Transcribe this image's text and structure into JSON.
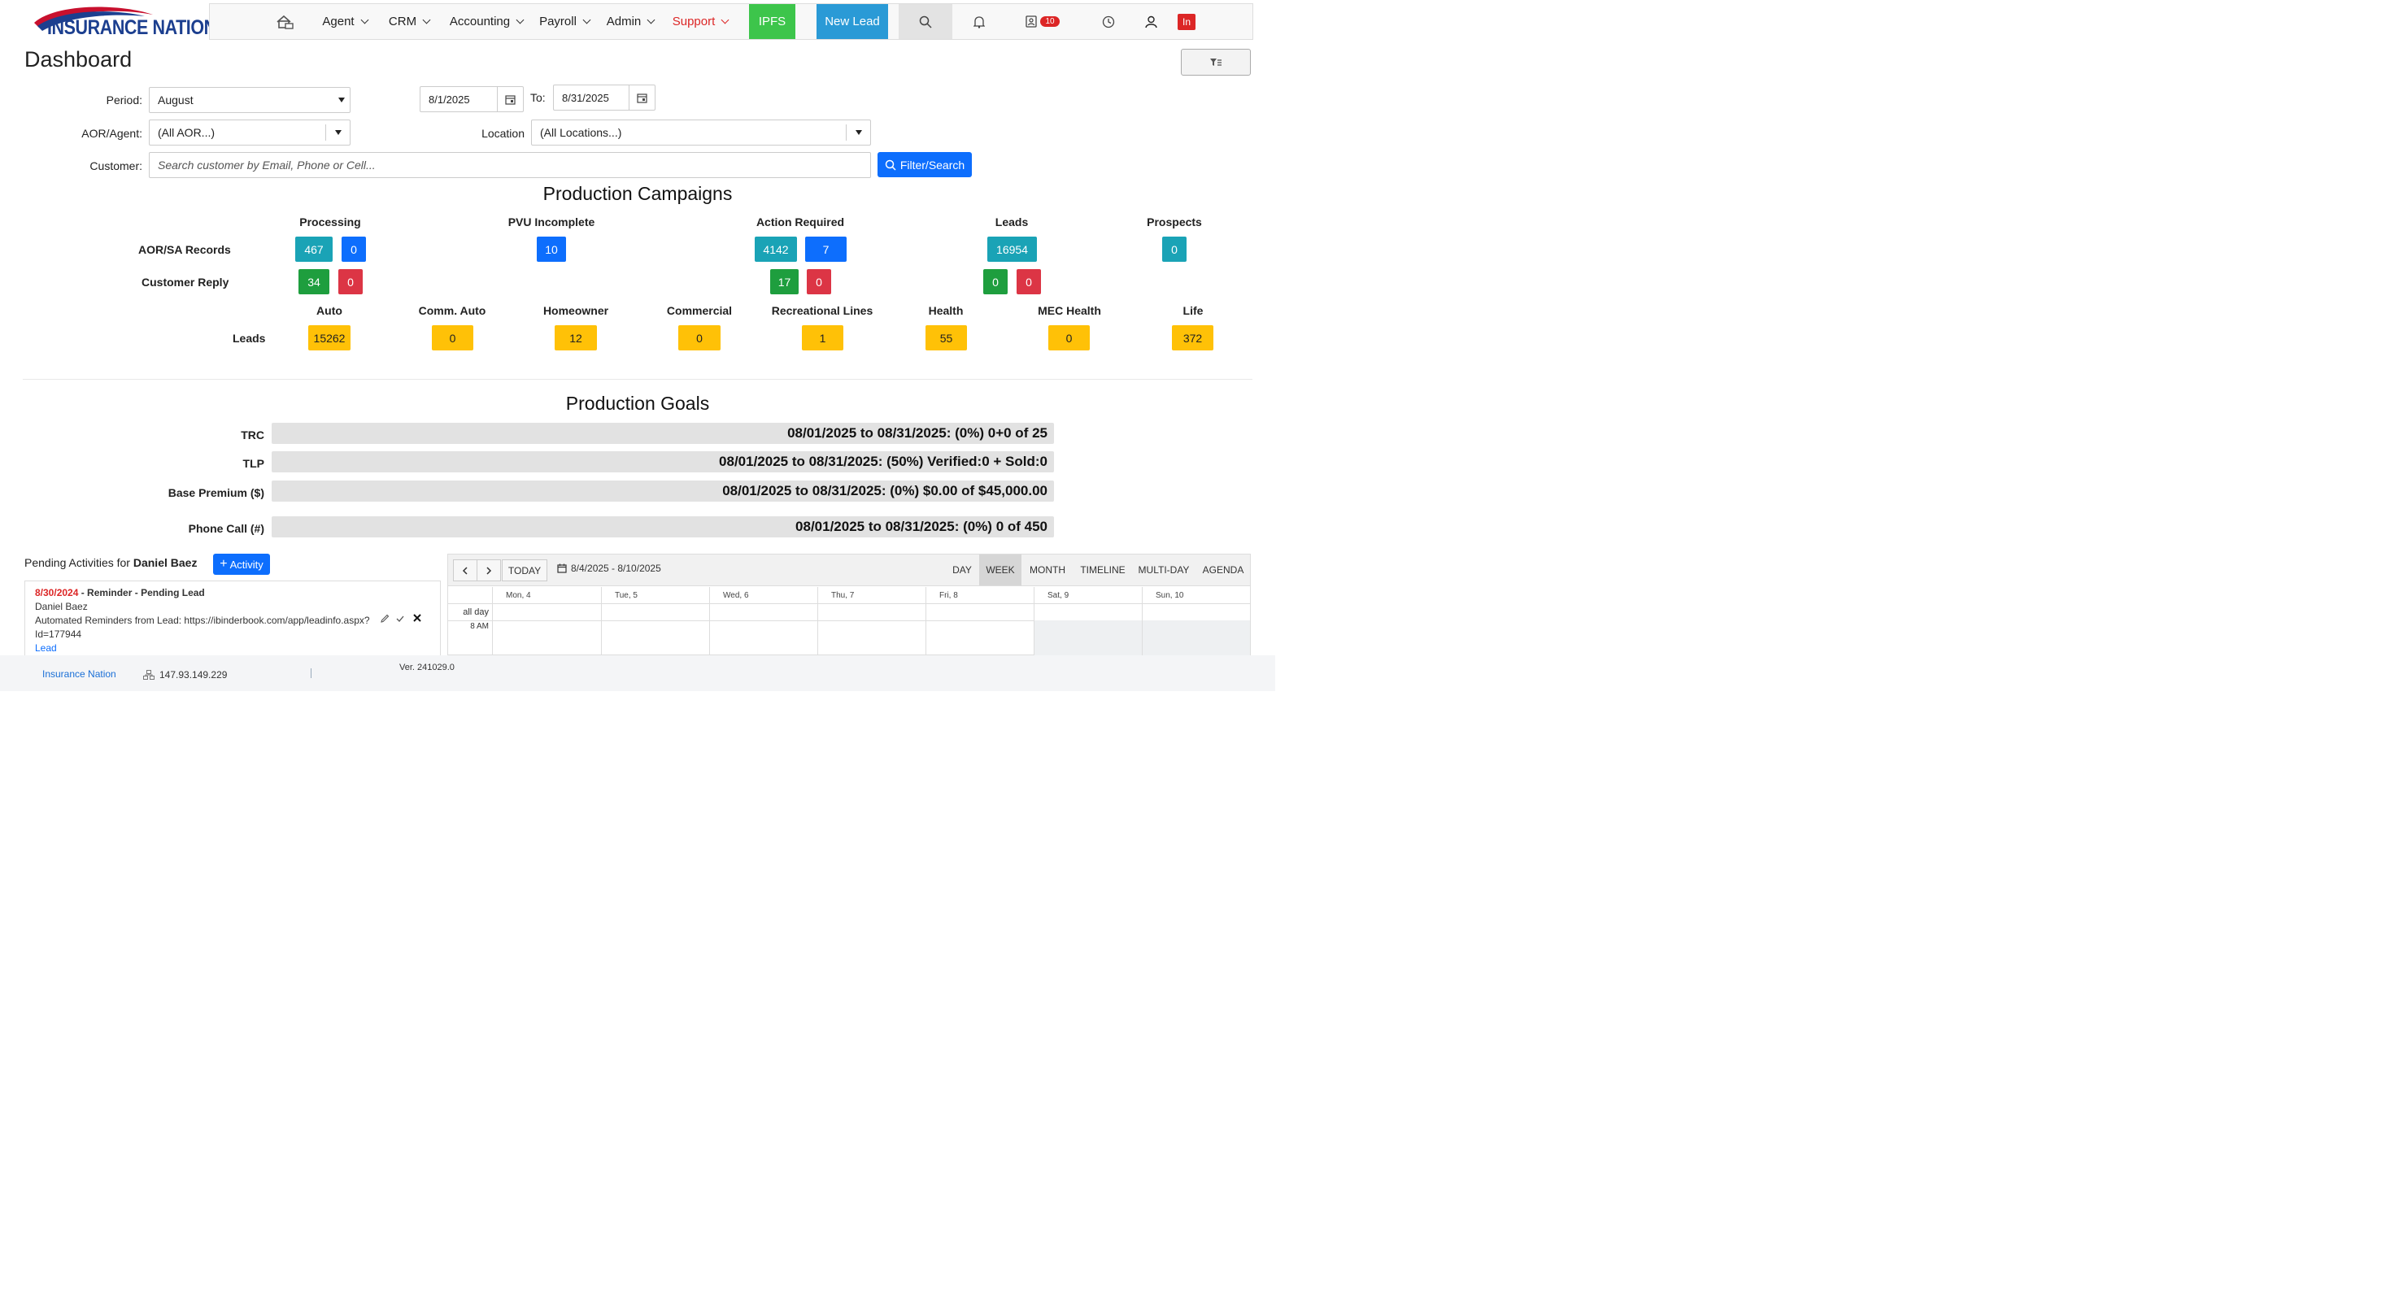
{
  "logo": {
    "text": "INSURANCE NATION"
  },
  "nav": {
    "items": [
      {
        "label": "Agent"
      },
      {
        "label": "CRM"
      },
      {
        "label": "Accounting"
      },
      {
        "label": "Payroll"
      },
      {
        "label": "Admin"
      },
      {
        "label": "Support"
      }
    ],
    "ipfs": "IPFS",
    "new_lead": "New Lead",
    "contacts_badge": "10",
    "user_initials": "In",
    "icons": [
      "home-icon",
      "search-icon",
      "bell-icon",
      "contacts-icon",
      "clock-icon",
      "user-icon"
    ],
    "colors": {
      "support": "#dc2626",
      "ipfs": "#3dc54b",
      "new_lead": "#2a9ad6"
    }
  },
  "page": {
    "title": "Dashboard"
  },
  "filters": {
    "period_label": "Period:",
    "period_value": "August",
    "date_from": "8/1/2025",
    "to_label": "To:",
    "date_to": "8/31/2025",
    "aor_label": "AOR/Agent:",
    "aor_value": "(All AOR...)",
    "location_label": "Location",
    "location_value": "(All Locations...)",
    "customer_label": "Customer:",
    "customer_placeholder": "Search customer by Email, Phone or Cell...",
    "filter_button": "Filter/Search"
  },
  "campaigns": {
    "title": "Production Campaigns",
    "headers": {
      "processing": "Processing",
      "pvu": "PVU Incomplete",
      "action": "Action Required",
      "leads": "Leads",
      "prospects": "Prospects"
    },
    "rows": {
      "aor": "AOR/SA Records",
      "reply": "Customer Reply",
      "leads": "Leads"
    },
    "aor_values": {
      "processing_a": "467",
      "processing_b": "0",
      "pvu": "10",
      "action_a": "4142",
      "action_b": "7",
      "leads": "16954",
      "prospects": "0"
    },
    "reply_values": {
      "processing_a": "34",
      "processing_b": "0",
      "action_a": "17",
      "action_b": "0",
      "leads_a": "0",
      "leads_b": "0"
    },
    "lead_types": [
      {
        "label": "Auto",
        "value": "15262"
      },
      {
        "label": "Comm. Auto",
        "value": "0"
      },
      {
        "label": "Homeowner",
        "value": "12"
      },
      {
        "label": "Commercial",
        "value": "0"
      },
      {
        "label": "Recreational Lines",
        "value": "1"
      },
      {
        "label": "Health",
        "value": "55"
      },
      {
        "label": "MEC Health",
        "value": "0"
      },
      {
        "label": "Life",
        "value": "372"
      }
    ]
  },
  "goals": {
    "title": "Production Goals",
    "items": [
      {
        "label": "TRC",
        "text": "08/01/2025 to 08/31/2025: (0%) 0+0 of 25"
      },
      {
        "label": "TLP",
        "text": "08/01/2025 to 08/31/2025: (50%) Verified:0 + Sold:0"
      },
      {
        "label": "Base Premium ($)",
        "text": "08/01/2025 to 08/31/2025: (0%) $0.00 of $45,000.00"
      },
      {
        "label": "Phone Call (#)",
        "text": "08/01/2025 to 08/31/2025: (0%) 0 of 450"
      }
    ]
  },
  "pending": {
    "title_prefix": "Pending Activities for ",
    "user": "Daniel Baez",
    "add_button": "Activity",
    "item": {
      "date": "8/30/2024",
      "title": " - Reminder - Pending Lead",
      "name": "Daniel Baez",
      "desc": "Automated Reminders from Lead: https://ibinderbook.com/app/leadinfo.aspx?",
      "desc2": "Id=177944",
      "link": "Lead"
    }
  },
  "calendar": {
    "today": "TODAY",
    "range": "8/4/2025 - 8/10/2025",
    "views": [
      "DAY",
      "WEEK",
      "MONTH",
      "TIMELINE",
      "MULTI-DAY",
      "AGENDA"
    ],
    "active_view": "WEEK",
    "days": [
      "Mon, 4",
      "Tue, 5",
      "Wed, 6",
      "Thu, 7",
      "Fri, 8",
      "Sat, 9",
      "Sun, 10"
    ],
    "allday": "all day",
    "time": "8 AM"
  },
  "footer": {
    "brand": "Insurance Nation",
    "ip": "147.93.149.229",
    "version": "Ver. 241029.0"
  }
}
